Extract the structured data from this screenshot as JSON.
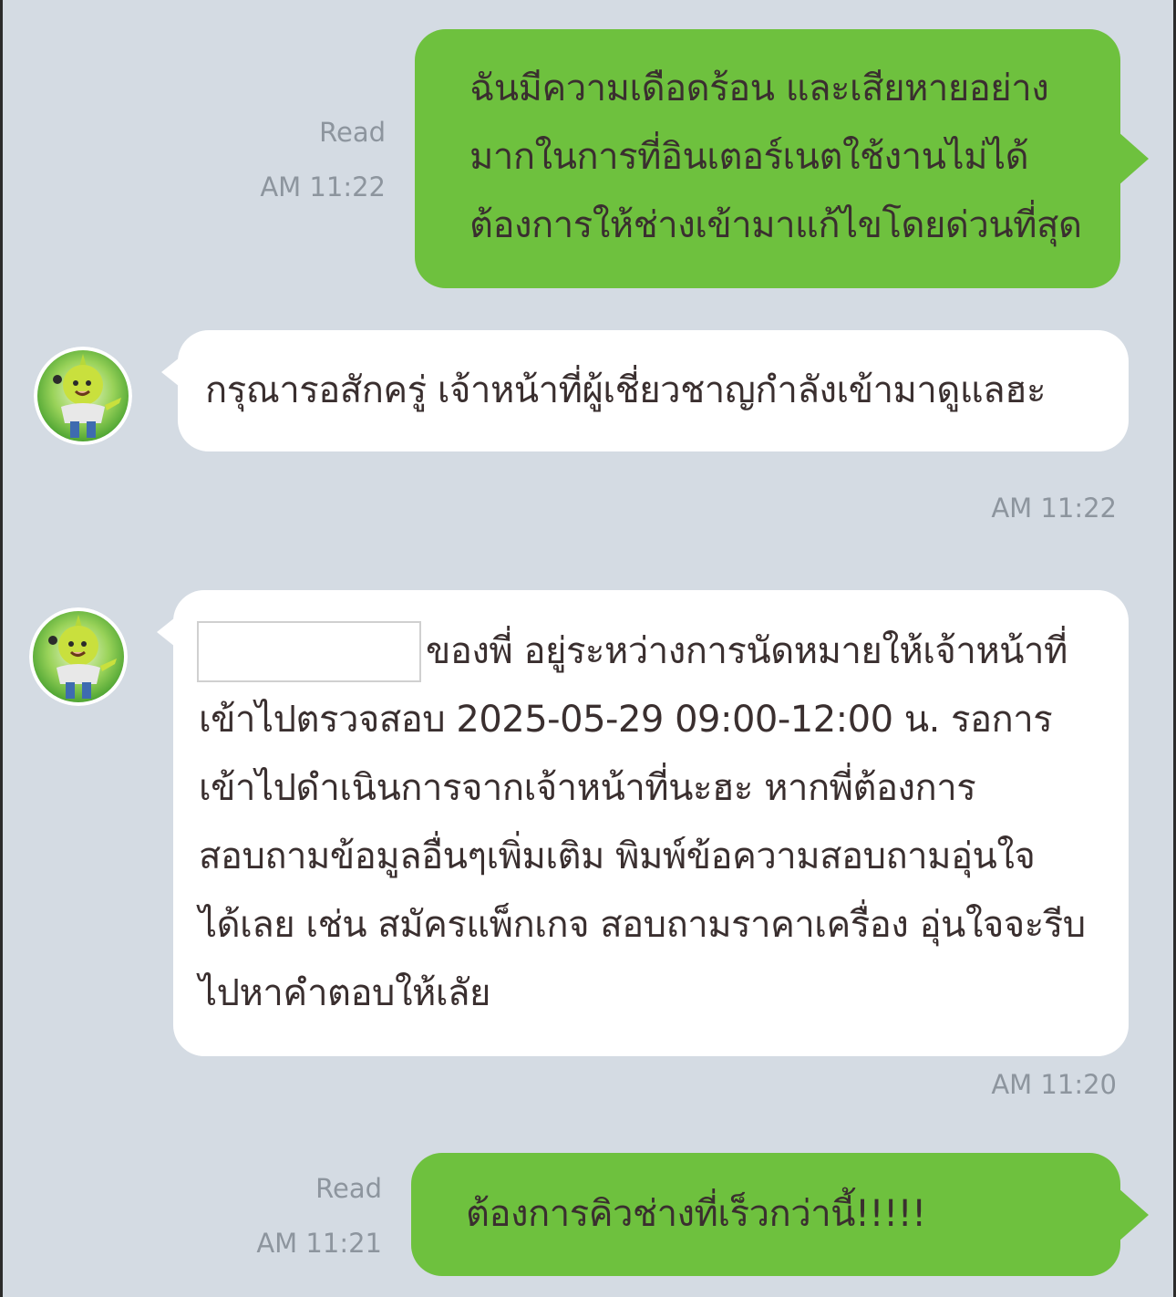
{
  "chat": {
    "messages": [
      {
        "text": "ฉันมีความเดือดร้อน และเสียหายอย่าง\nมากในการที่อินเตอร์เนตใช้งานไม่ได้\nต้องการให้ช่างเข้ามาแก้ไขโดยด่วนที่สุด",
        "read": "Read",
        "time": "AM 11:22"
      },
      {
        "text": "กรุณารอสักครู่ เจ้าหน้าที่ผู้เชี่ยวชาญกำลังเข้ามาดูแลฮะ",
        "time": "AM 11:22"
      },
      {
        "text_line1": "ของพี่ อยู่ระหว่างการนัดหมายให้เจ้าหน้าที่",
        "text_rest": "เข้าไปตรวจสอบ 2025-05-29 09:00-12:00 น. รอการ\nเข้าไปดำเนินการจากเจ้าหน้าที่นะฮะ หากพี่ต้องการ\nสอบถามข้อมูลอื่นๆเพิ่มเติม พิมพ์ข้อความสอบถามอุ่นใจ\nได้เลย เช่น สมัครแพ็กเกจ สอบถามราคาเครื่อง อุ่นใจจะรีบ\nไปหาคำตอบให้เลัย",
        "time": "AM 11:20"
      },
      {
        "text": "ต้องการคิวช่างที่เร็วกว่านี้!!!!!",
        "read": "Read",
        "time": "AM 11:21"
      }
    ]
  },
  "colors": {
    "background": "#d4dbe3",
    "outgoing_bubble": "#6ec13e",
    "incoming_bubble": "#ffffff",
    "meta_text": "#8d959e"
  },
  "icons": {
    "bot_avatar": "green-mascot-avatar-icon"
  }
}
